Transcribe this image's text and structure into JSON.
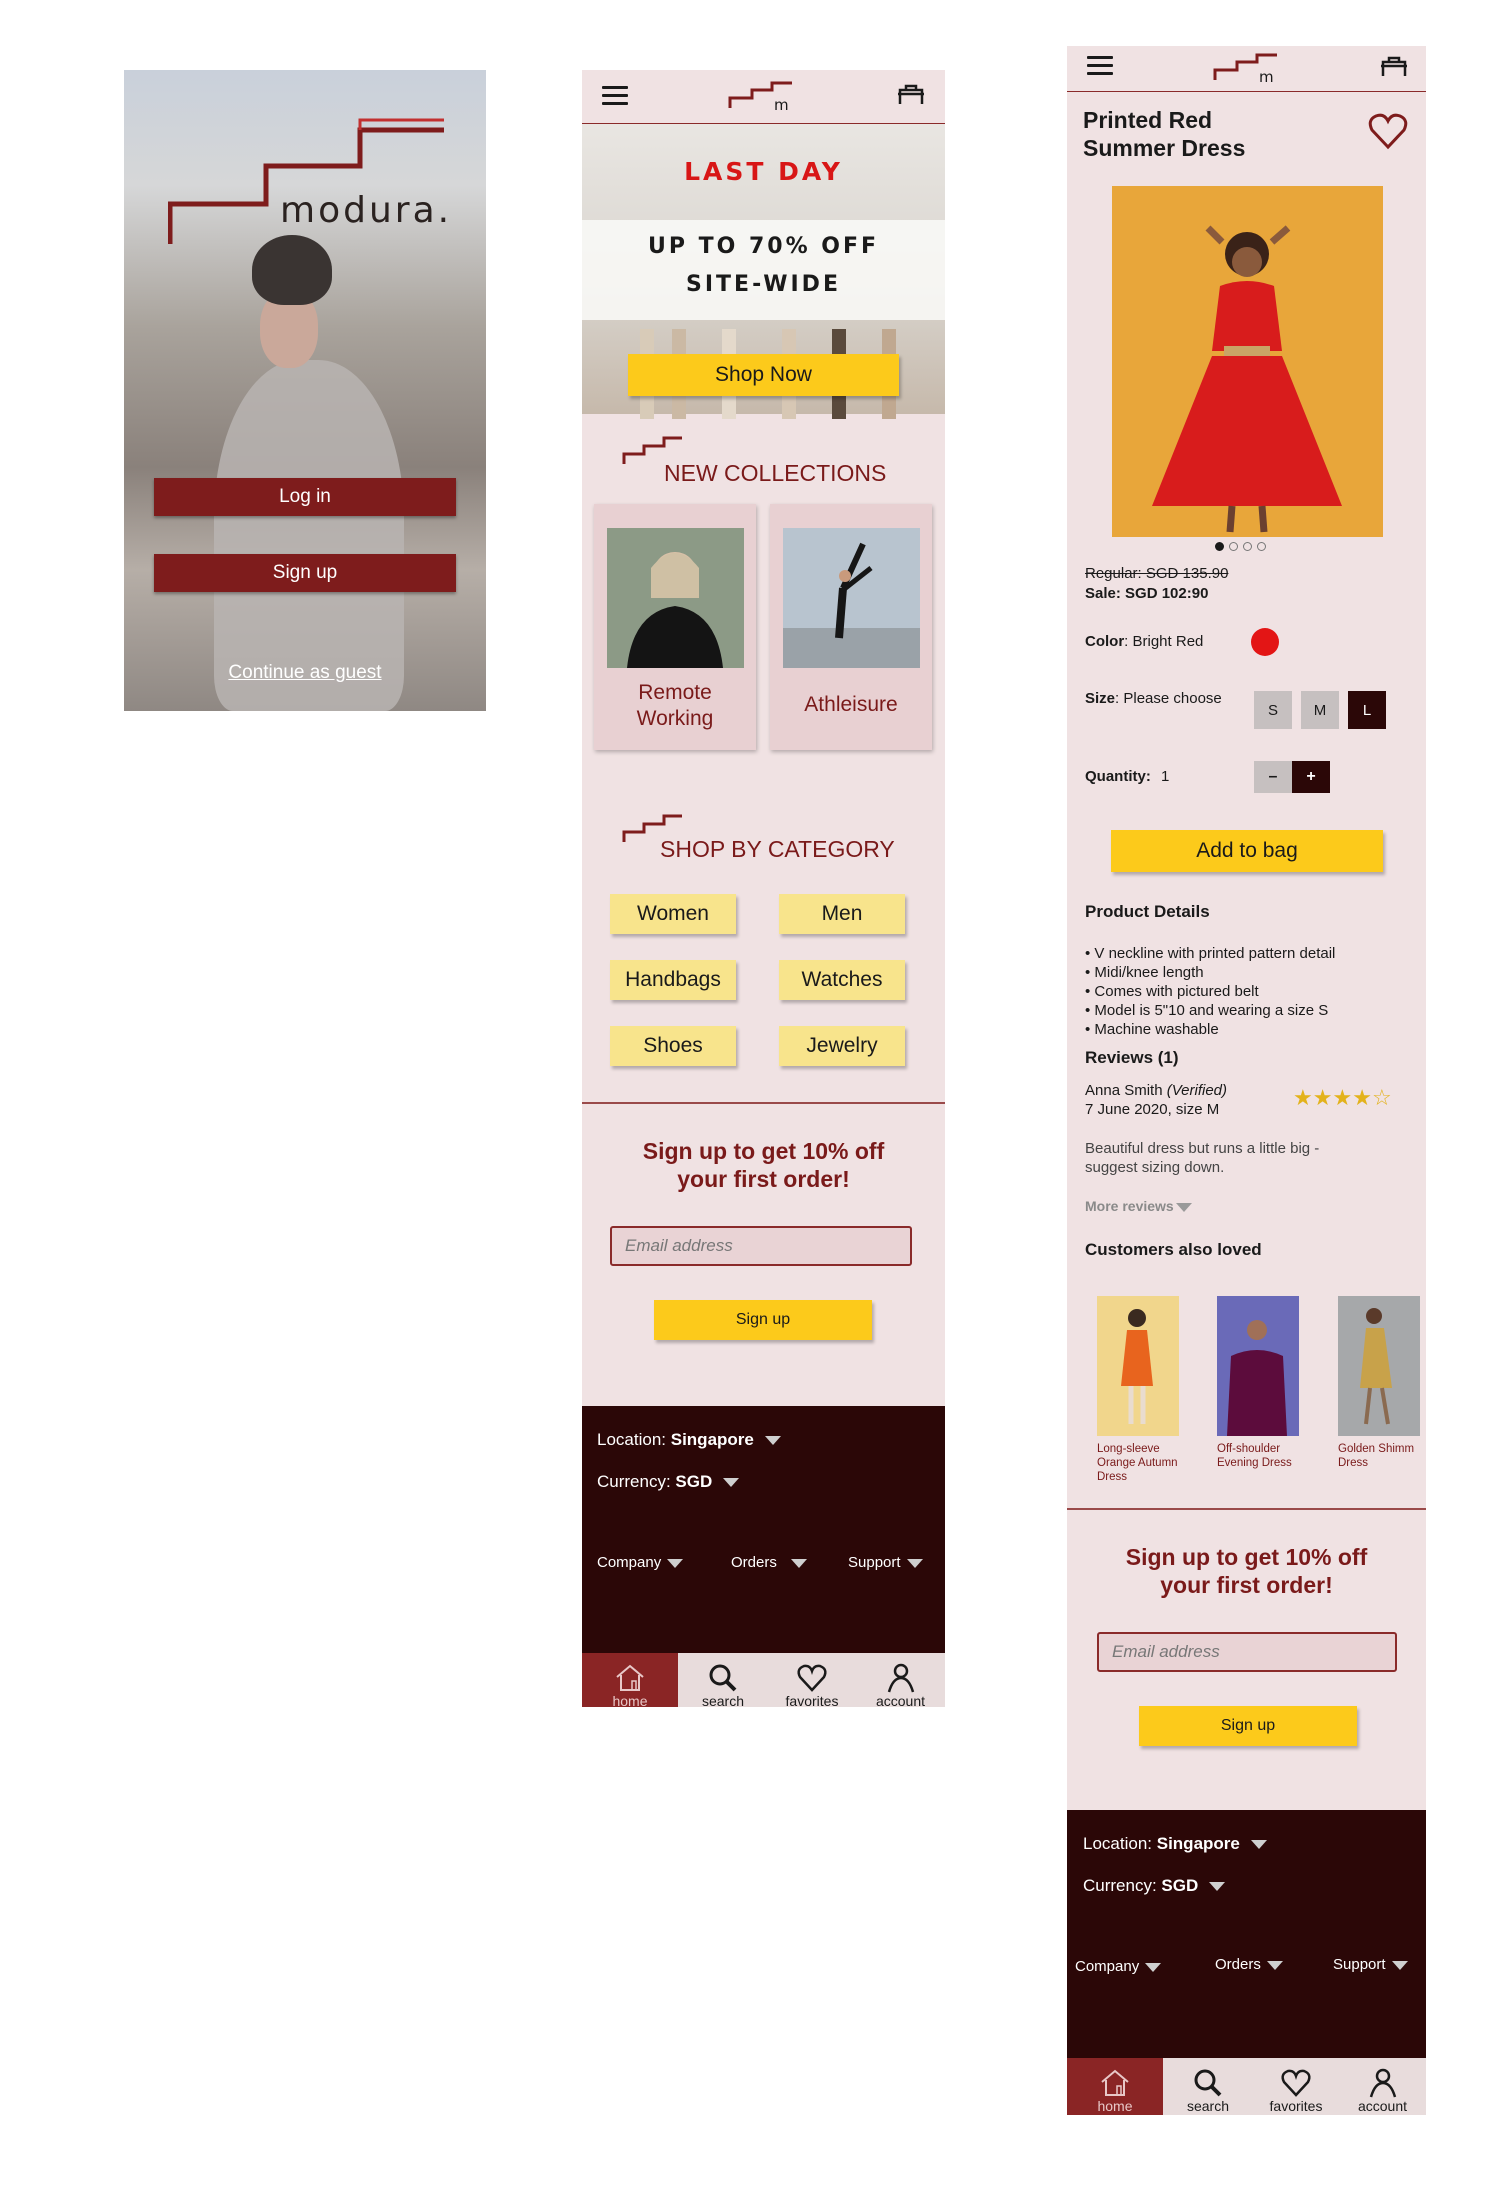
{
  "login": {
    "brand": "modura.",
    "login_label": "Log in",
    "signup_label": "Sign up",
    "guest_label": "Continue as guest"
  },
  "home": {
    "logo_letter": "m",
    "hero": {
      "kicker": "LAST DAY",
      "line1": "UP TO 70% OFF",
      "line2": "SITE-WIDE",
      "cta": "Shop Now"
    },
    "collections_title": "NEW COLLECTIONS",
    "collections": [
      {
        "label_line1": "Remote",
        "label_line2": "Working"
      },
      {
        "label_line1": "Athleisure",
        "label_line2": ""
      }
    ],
    "category_title": "SHOP BY CATEGORY",
    "categories": [
      "Women",
      "Men",
      "Handbags",
      "Watches",
      "Shoes",
      "Jewelry"
    ],
    "signup": {
      "line1": "Sign up to get 10% off",
      "line2": "your first order!",
      "email_placeholder": "Email address",
      "button": "Sign up"
    }
  },
  "footer": {
    "location_label": "Location:",
    "location_value": "Singapore",
    "currency_label": "Currency:",
    "currency_value": "SGD",
    "links": [
      "Company",
      "Orders",
      "Support"
    ]
  },
  "tabs": [
    "home",
    "search",
    "favorites",
    "account"
  ],
  "product": {
    "name_line1": "Printed Red",
    "name_line2": "Summer Dress",
    "image_count": 4,
    "active_image": 1,
    "regular_price": "Regular: SGD 135.90",
    "sale_label": "Sale:",
    "sale_value": "SGD 102:90",
    "color_label": "Color",
    "color_value": ": Bright Red",
    "color_swatch": "#e31515",
    "size_label": "Size",
    "size_value": ": Please choose",
    "sizes": [
      "S",
      "M",
      "L"
    ],
    "selected_size": "L",
    "quantity_label": "Quantity:",
    "quantity_value": "1",
    "minus": "–",
    "plus": "+",
    "add_to_bag": "Add to bag",
    "details_title": "Product Details",
    "details": [
      "• V neckline with printed pattern detail",
      "• Midi/knee length",
      "• Comes with pictured belt",
      "• Model is 5\"10 and wearing a size S",
      "• Machine washable"
    ],
    "reviews_title": "Reviews (1)",
    "review": {
      "author": "Anna Smith",
      "verified": "(Verified)",
      "meta": "7 June 2020, size M",
      "rating": 4,
      "max_rating": 5,
      "text_line1": "Beautiful dress but runs a little big -",
      "text_line2": "suggest sizing down."
    },
    "more_reviews": "More reviews",
    "also_loved_title": "Customers also loved",
    "also_loved": [
      {
        "l1": "Long-sleeve",
        "l2": "Orange Autumn",
        "l3": "Dress"
      },
      {
        "l1": "Off-shoulder",
        "l2": "Evening Dress",
        "l3": ""
      },
      {
        "l1": "Golden Shimm",
        "l2": "Dress",
        "l3": ""
      }
    ]
  },
  "colors": {
    "maroon": "#7e1c1c",
    "dark_maroon": "#2b0707",
    "yellow": "#fcca1b",
    "pink_bg": "#f0e2e3"
  }
}
